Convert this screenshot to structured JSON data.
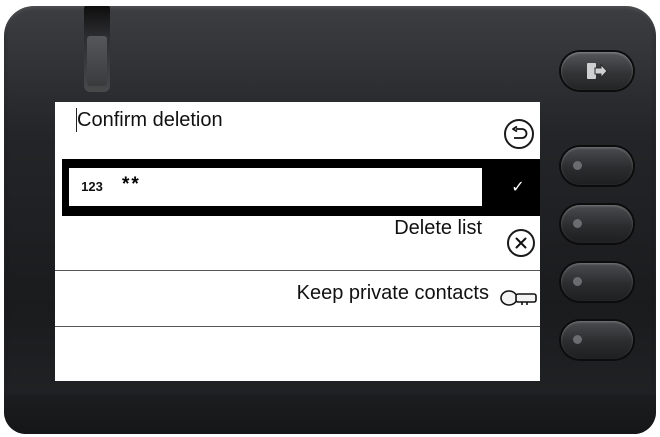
{
  "screen": {
    "title": "Confirm deletion",
    "input": {
      "mode_label": "123",
      "value": "**"
    },
    "options": [
      {
        "label": "Delete list",
        "icon": "close-icon"
      },
      {
        "label": "Keep private contacts",
        "icon": "key-icon"
      }
    ],
    "ok_glyph": "✓"
  },
  "icons": {
    "back": "back-arrow-icon",
    "exit": "exit-icon",
    "ok": "check-icon"
  },
  "colors": {
    "highlight_row": "#000000",
    "screen_bg": "#ffffff",
    "device_body": "#242528"
  }
}
